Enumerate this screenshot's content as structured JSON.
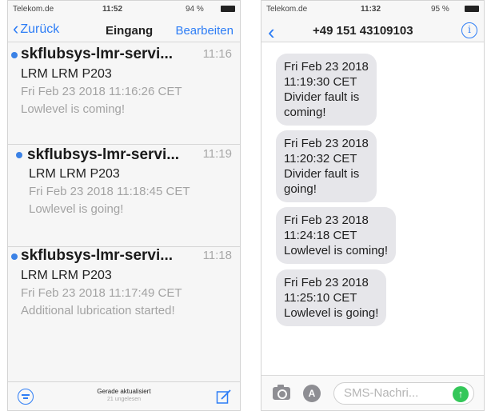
{
  "left_phone": {
    "status": {
      "carrier": "Telekom.de",
      "time": "11:52",
      "battery": "94 %"
    },
    "nav": {
      "back": "Zurück",
      "title": "Eingang",
      "edit": "Bearbeiten"
    },
    "mails": [
      {
        "sender": "skflubsys-lmr-servi...",
        "time": "11:16",
        "subject": "LRM LRM P203",
        "line3": "Fri Feb 23 2018 11:16:26 CET",
        "line4": "Lowlevel is coming!"
      },
      {
        "sender": "skflubsys-lmr-servi...",
        "time": "11:19",
        "subject": "LRM LRM P203",
        "line3": "Fri Feb 23 2018 11:18:45 CET",
        "line4": "Lowlevel is going!"
      },
      {
        "sender": "skflubsys-lmr-servi...",
        "time": "11:18",
        "subject": "LRM LRM P203",
        "line3": "Fri Feb 23 2018 11:17:49 CET",
        "line4": "Additional lubrication started!"
      }
    ],
    "bottom": {
      "status": "Gerade aktualisiert",
      "unread": "21 ungelesen"
    }
  },
  "right_phone": {
    "status": {
      "carrier": "Telekom.de",
      "time": "11:32",
      "battery": "95 %"
    },
    "contact": "+49 151 43109103",
    "messages": [
      {
        "line1": "Fri Feb 23 2018",
        "line2": "11:19:30 CET",
        "line3": "Divider fault is",
        "line4": "coming!"
      },
      {
        "line1": "Fri Feb 23 2018",
        "line2": "11:20:32 CET",
        "line3": "Divider fault is",
        "line4": "going!"
      },
      {
        "line1": "Fri Feb 23 2018",
        "line2": "11:24:18 CET",
        "line3": "Lowlevel is coming!"
      },
      {
        "line1": "Fri Feb 23 2018",
        "line2": "11:25:10 CET",
        "line3": "Lowlevel is going!"
      }
    ],
    "input_placeholder": "SMS-Nachri..."
  },
  "icons": {
    "back": "chevron-left-icon",
    "filter": "filter-icon",
    "compose": "compose-icon",
    "info": "info-icon",
    "camera": "camera-icon",
    "apps": "app-store-icon",
    "send": "send-arrow-icon"
  },
  "colors": {
    "accent": "#2d7df6",
    "unread_dot": "#3b82e6",
    "bubble": "#e6e6ea",
    "send": "#34c759"
  }
}
